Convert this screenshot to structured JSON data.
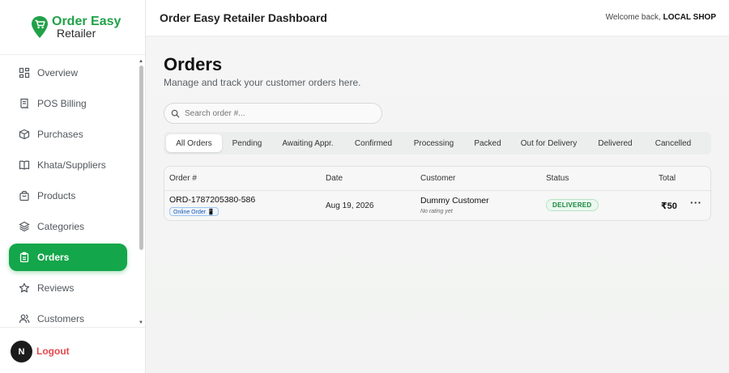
{
  "brand": {
    "line1": "Order Easy",
    "line2": "Retailer",
    "color": "#21a148"
  },
  "sidebar": {
    "items": [
      {
        "label": "Overview",
        "icon": "grid-icon",
        "active": false
      },
      {
        "label": "POS Billing",
        "icon": "receipt-icon",
        "active": false
      },
      {
        "label": "Purchases",
        "icon": "box-icon",
        "active": false
      },
      {
        "label": "Khata/Suppliers",
        "icon": "book-icon",
        "active": false
      },
      {
        "label": "Products",
        "icon": "bag-icon",
        "active": false
      },
      {
        "label": "Categories",
        "icon": "layers-icon",
        "active": false
      },
      {
        "label": "Orders",
        "icon": "clipboard-icon",
        "active": true
      },
      {
        "label": "Reviews",
        "icon": "star-icon",
        "active": false
      },
      {
        "label": "Customers",
        "icon": "users-icon",
        "active": false
      }
    ],
    "footer": {
      "badge": "N",
      "logout_label": "Logout"
    }
  },
  "header": {
    "title": "Order Easy Retailer Dashboard",
    "welcome_prefix": "Welcome back, ",
    "shop_name": "LOCAL SHOP"
  },
  "main": {
    "title": "Orders",
    "subtitle": "Manage and track your customer orders here.",
    "search": {
      "placeholder": "Search order #...",
      "value": ""
    },
    "tabs": [
      {
        "label": "All Orders",
        "active": true
      },
      {
        "label": "Pending",
        "active": false
      },
      {
        "label": "Awaiting Appr.",
        "active": false
      },
      {
        "label": "Confirmed",
        "active": false
      },
      {
        "label": "Processing",
        "active": false
      },
      {
        "label": "Packed",
        "active": false
      },
      {
        "label": "Out for Delivery",
        "active": false
      },
      {
        "label": "Delivered",
        "active": false
      },
      {
        "label": "Cancelled",
        "active": false
      }
    ],
    "table": {
      "columns": [
        "Order #",
        "Date",
        "Customer",
        "Status",
        "Total"
      ],
      "rows": [
        {
          "order_number": "ORD-1787205380-586",
          "badge": "Online Order 📱",
          "date": "Aug 19, 2026",
          "customer": "Dummy Customer",
          "rating": "No rating yet",
          "status": "DELIVERED",
          "total": "₹50",
          "actions": "···"
        }
      ]
    }
  },
  "colors": {
    "accent": "#14a64a",
    "status_delivered": "#16843d",
    "logout": "#e5484d"
  }
}
